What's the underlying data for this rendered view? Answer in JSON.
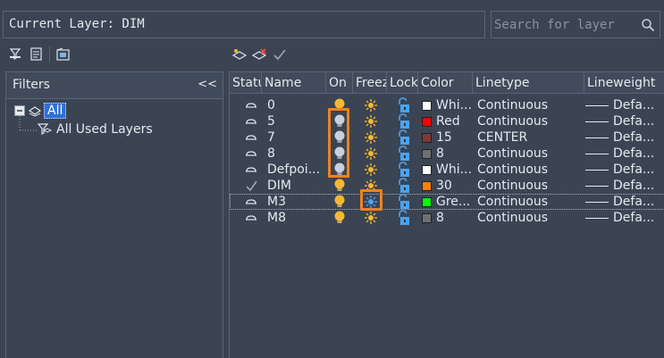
{
  "header": {
    "current_layer_text": "Current Layer: DIM",
    "search_placeholder": "Search for layer"
  },
  "filters": {
    "title": "Filters",
    "collapse_label": "<<",
    "tree": {
      "root_label": "All",
      "child_label": "All Used Layers"
    }
  },
  "columns": [
    "Status",
    "Name",
    "On",
    "Freeze",
    "Lock",
    "Color",
    "Linetype",
    "Lineweight"
  ],
  "layers": [
    {
      "status": "layer",
      "name": "0",
      "on": true,
      "freeze": false,
      "lock": false,
      "color_name": "Whi...",
      "color": "#ffffff",
      "linetype": "Continuous",
      "lineweight": "Defa..."
    },
    {
      "status": "layer",
      "name": "5",
      "on": false,
      "freeze": false,
      "lock": false,
      "color_name": "Red",
      "color": "#ff0000",
      "linetype": "Continuous",
      "lineweight": "Defa..."
    },
    {
      "status": "layer",
      "name": "7",
      "on": false,
      "freeze": false,
      "lock": false,
      "color_name": "15",
      "color": "#803838",
      "linetype": "CENTER",
      "lineweight": "Defa..."
    },
    {
      "status": "layer",
      "name": "8",
      "on": false,
      "freeze": false,
      "lock": false,
      "color_name": "8",
      "color": "#707070",
      "linetype": "Continuous",
      "lineweight": "Defa..."
    },
    {
      "status": "layer",
      "name": "Defpoi...",
      "on": false,
      "freeze": false,
      "lock": false,
      "color_name": "Whi...",
      "color": "#ffffff",
      "linetype": "Continuous",
      "lineweight": "Defa..."
    },
    {
      "status": "current",
      "name": "DIM",
      "on": true,
      "freeze": false,
      "lock": false,
      "color_name": "30",
      "color": "#ff7f00",
      "linetype": "Continuous",
      "lineweight": "Defa..."
    },
    {
      "status": "layer",
      "name": "M3",
      "on": true,
      "freeze": true,
      "lock": false,
      "color_name": "Gre...",
      "color": "#00ff00",
      "linetype": "Continuous",
      "lineweight": "Defa..."
    },
    {
      "status": "layer",
      "name": "M8",
      "on": true,
      "freeze": false,
      "lock": false,
      "color_name": "8",
      "color": "#707070",
      "linetype": "Continuous",
      "lineweight": "Defa..."
    }
  ],
  "colors": {
    "bulb_on": "#f5b833",
    "bulb_off": "#c7d0dc",
    "sun": "#f5b833",
    "frozen": "#4aa3f0",
    "lock": "#4aa3f0",
    "highlight": "#f0821e"
  }
}
